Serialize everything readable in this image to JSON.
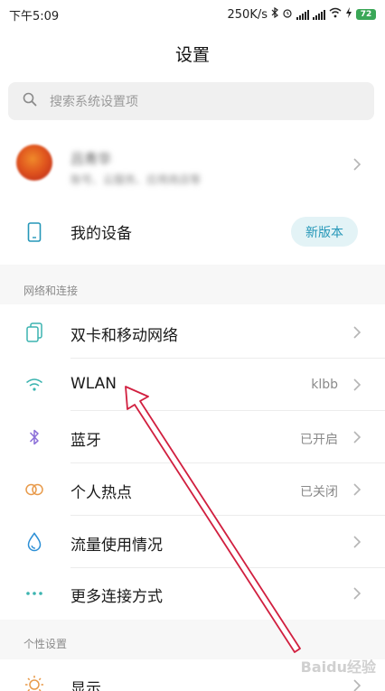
{
  "status": {
    "time": "下午5:09",
    "speed": "250K/s",
    "battery": "72"
  },
  "header": {
    "title": "设置"
  },
  "search": {
    "placeholder": "搜索系统设置项"
  },
  "profile": {
    "name": "吕青华",
    "subtitle": "账号、云服务、应用商店等"
  },
  "device": {
    "label": "我的设备",
    "badge": "新版本"
  },
  "sections": {
    "network": "网络和连接",
    "personal": "个性设置"
  },
  "network_items": [
    {
      "label": "双卡和移动网络",
      "value": ""
    },
    {
      "label": "WLAN",
      "value": "klbb"
    },
    {
      "label": "蓝牙",
      "value": "已开启"
    },
    {
      "label": "个人热点",
      "value": "已关闭"
    },
    {
      "label": "流量使用情况",
      "value": ""
    },
    {
      "label": "更多连接方式",
      "value": ""
    }
  ],
  "personal_items": [
    {
      "label": "显示",
      "value": ""
    }
  ],
  "watermark": "Baidu经验",
  "colors": {
    "accent": "#2597b8",
    "annotation_arrow": "#d11f3f",
    "battery": "#3aa757"
  }
}
